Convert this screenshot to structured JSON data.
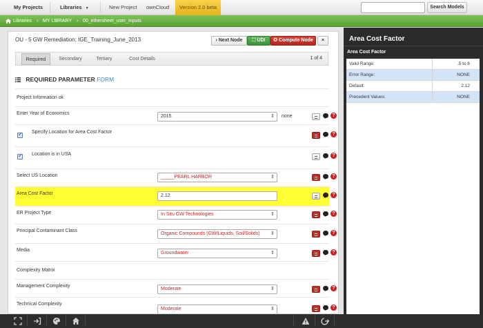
{
  "topnav": {
    "my_projects": "My Projects",
    "libraries": "Libraries",
    "libraries_caret": "▼",
    "new_project": "New Project",
    "owncloud": "ownCloud",
    "version": "Version 2.0 beta",
    "search_placeholder": "",
    "search_button": "Search Models"
  },
  "breadcrumb": {
    "items": [
      "Libraries",
      "MY LIBRARY",
      "00_ethersheet_user_inputs"
    ],
    "separator": "›"
  },
  "header": {
    "title": "OU - 5 GW Remediation; IGE_Training_June_2013",
    "next_node": "› Next Node",
    "udi": "⛶ UDI",
    "compute_node": "✪ Compute Node",
    "close": "×"
  },
  "tabs": {
    "items": [
      "Required",
      "Secondary",
      "Tertiary",
      "Cost Details"
    ],
    "active": 0,
    "page_indicator": "1 of 4"
  },
  "section": {
    "title": "REQUIRED PARAMETER",
    "suffix": "FORM"
  },
  "rows": [
    {
      "label": "Project Information ok"
    },
    {
      "label": "Enter Year of Economics",
      "value": "2015",
      "unit": "none"
    },
    {
      "label": "Specify Location for Area Cost Factor",
      "checked": true
    },
    {
      "label": "Location is in USA",
      "checked": true
    },
    {
      "label": "Select US Location",
      "value": "_____PEARL HARBOR"
    },
    {
      "label": "Area Cost Factor",
      "value": "2.12"
    },
    {
      "label": "ER Project Type",
      "value": "In Situ GW Technologies"
    },
    {
      "label": "Principal Contaminant Class",
      "value": "Organic Compounds (GW/Liquids, Soil/Solids)"
    },
    {
      "label": "Media",
      "value": "Groundwater"
    },
    {
      "label": "Complexity Matrix"
    },
    {
      "label": "Management Complexity",
      "value": "Moderate"
    },
    {
      "label": "Technical Complexity",
      "value": "Moderate"
    }
  ],
  "help_glyph": "?",
  "right_panel": {
    "title": "Area Cost Factor",
    "subtitle": "Area Cost Factor",
    "rows": [
      {
        "key": "Valid Range:",
        "value": ".5 to 6"
      },
      {
        "key": "Error Range:",
        "value": "NONE"
      },
      {
        "key": "Default:",
        "value": "2.12"
      },
      {
        "key": "Precedent Values:",
        "value": "NONE"
      }
    ]
  },
  "bottombar": {
    "icons": [
      "fullscreen-icon",
      "sign-in-icon",
      "palette-icon",
      "home-icon",
      "warning-icon",
      "logout-icon"
    ]
  }
}
